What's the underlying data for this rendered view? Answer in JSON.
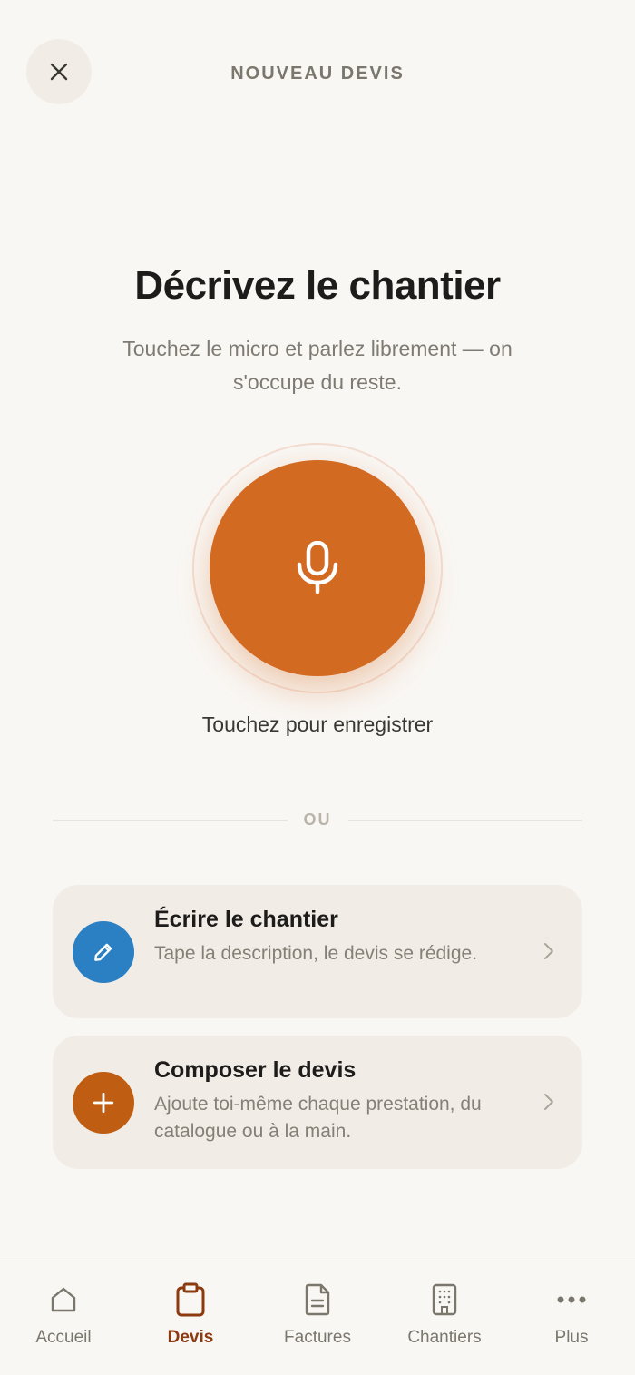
{
  "header": {
    "title": "NOUVEAU DEVIS",
    "close_icon": "close-icon"
  },
  "hero": {
    "title": "Décrivez le chantier",
    "subtitle": "Touchez le micro et parlez librement — on s'occupe du reste."
  },
  "recorder": {
    "icon": "microphone-icon",
    "caption": "Touchez pour enregistrer",
    "accent_color": "#d36a22"
  },
  "divider": {
    "label": "OU"
  },
  "options": [
    {
      "title": "Écrire le chantier",
      "description": "Tape la description, le devis se rédige.",
      "icon": "pencil-icon",
      "color": "#2b7fc3"
    },
    {
      "title": "Composer le devis",
      "description": "Ajoute toi-même chaque prestation, du catalogue ou à la main.",
      "icon": "plus-icon",
      "color": "#bf5e12"
    }
  ],
  "nav": {
    "active": "Devis",
    "items": [
      {
        "label": "Accueil",
        "icon": "home-icon"
      },
      {
        "label": "Devis",
        "icon": "clipboard-icon"
      },
      {
        "label": "Factures",
        "icon": "document-icon"
      },
      {
        "label": "Chantiers",
        "icon": "building-icon"
      },
      {
        "label": "Plus",
        "icon": "more-icon"
      }
    ]
  }
}
